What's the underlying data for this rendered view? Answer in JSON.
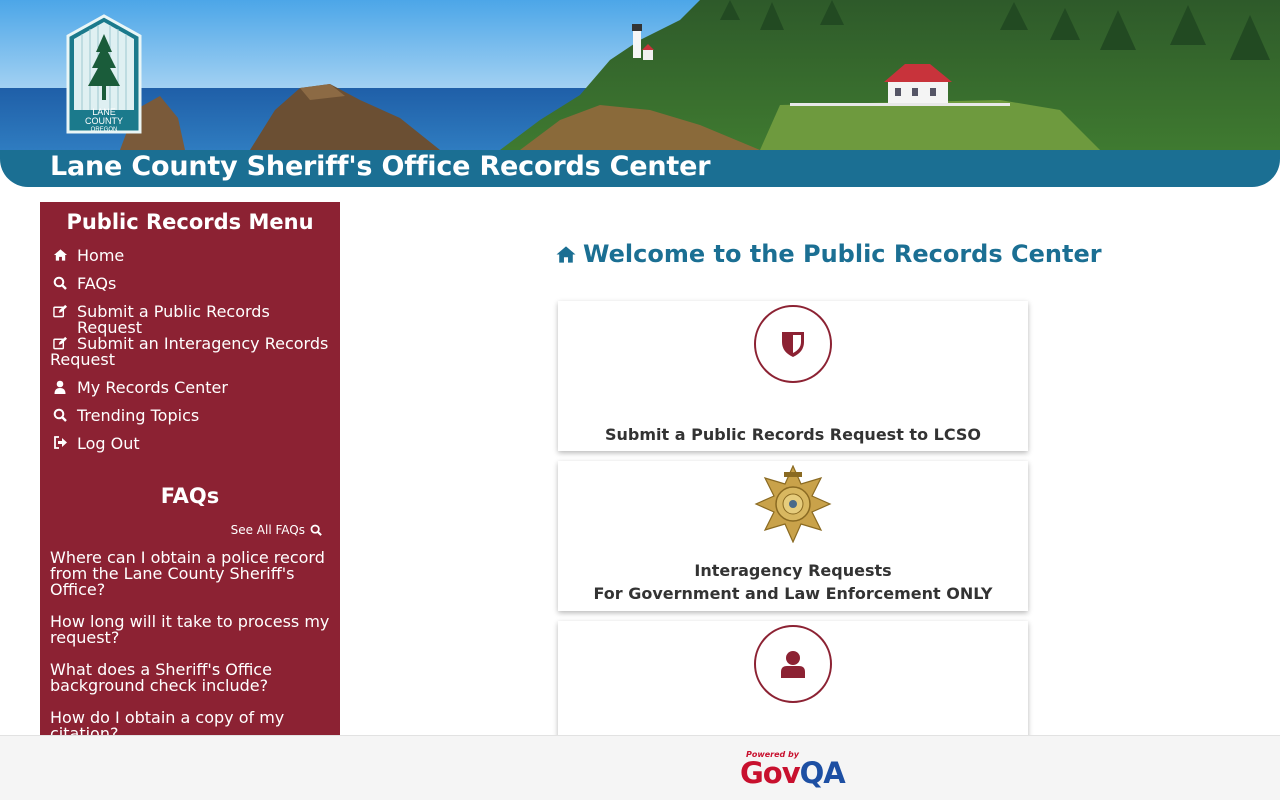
{
  "header": {
    "site_title": "Lane County Sheriff's Office Records Center",
    "logo_text_line1": "LANE",
    "logo_text_line2": "COUNTY",
    "logo_text_line3": "OREGON"
  },
  "sidebar": {
    "menu_title": "Public Records Menu",
    "menu_items": [
      {
        "label": "Home",
        "icon": "home-icon"
      },
      {
        "label": "FAQs",
        "icon": "search-icon"
      },
      {
        "label": "Submit a Public Records Request",
        "icon": "edit-icon"
      },
      {
        "label": "Submit an Interagency Records Request",
        "icon": "edit-icon"
      },
      {
        "label": "My Records Center",
        "icon": "user-icon"
      },
      {
        "label": "Trending Topics",
        "icon": "search-icon"
      },
      {
        "label": "Log Out",
        "icon": "sign-out-icon"
      }
    ],
    "faqs_title": "FAQs",
    "see_all_label": "See All FAQs",
    "faq_items": [
      "Where can I obtain a police record from the Lane County Sheriff's Office?",
      "How long will it take to process my request?",
      "What does a Sheriff's Office background check include?",
      "How do I obtain a copy of my citation?"
    ]
  },
  "main": {
    "welcome_title": "Welcome to the Public Records Center",
    "cards": [
      {
        "label": "Submit a Public Records Request to LCSO",
        "icon": "shield-icon"
      },
      {
        "label_line1": "Interagency Requests",
        "label_line2": "For Government and Law Enforcement ONLY",
        "icon": "sheriff-badge-icon"
      },
      {
        "label": "",
        "icon": "user-icon"
      }
    ]
  },
  "footer": {
    "powered_by": "Powered by",
    "brand_gov": "Gov",
    "brand_qa": "QA"
  },
  "colors": {
    "header_blue": "#1b6f93",
    "sidebar_maroon": "#8c2233",
    "brand_red": "#c8102e",
    "brand_blue": "#1d4fa3"
  }
}
